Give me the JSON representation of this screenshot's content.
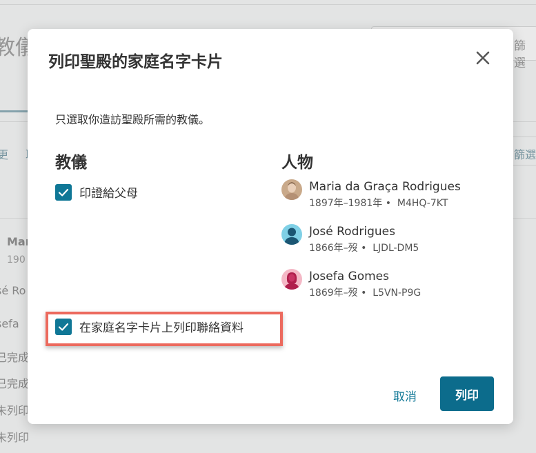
{
  "background": {
    "title": "教儀",
    "filter_label": "篩選",
    "filter_label_2": "篩選",
    "links": "更 取",
    "person_name": "Mar",
    "person_sub": "190",
    "rows": [
      "sé Ro",
      "sefa",
      "已完成",
      "已完成",
      "未列印",
      "未列印"
    ]
  },
  "modal": {
    "title": "列印聖殿的家庭名字卡片",
    "intro": "只選取你造訪聖殿所需的教儀。",
    "ordinances_heading": "教儀",
    "ordinance_option": "印證給父母",
    "people_heading": "人物",
    "people": [
      {
        "name": "Maria da Graça Rodrigues",
        "meta": "1897年–1981年 •  M4HQ-7KT",
        "avatar": "female-portrait-avatar-icon"
      },
      {
        "name": "José Rodrigues",
        "meta": "1866年–歿 •  LJDL-DM5",
        "avatar": "male-avatar-icon"
      },
      {
        "name": "Josefa Gomes",
        "meta": "1869年–歿 •  L5VN-P9G",
        "avatar": "female-avatar-icon"
      }
    ],
    "contact_option": "在家庭名字卡片上列印聯絡資料",
    "cancel_label": "取消",
    "print_label": "列印"
  },
  "colors": {
    "accent": "#0f7796",
    "primary_button": "#0c6c8c",
    "highlight_border": "#ec6a5e"
  }
}
